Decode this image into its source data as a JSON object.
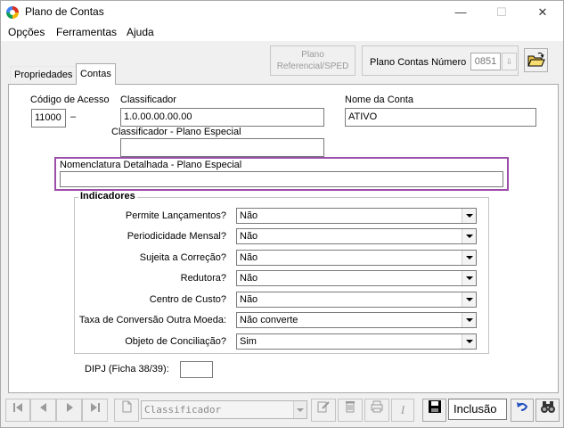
{
  "window": {
    "title": "Plano de Contas",
    "minimize": "—",
    "maximize": "☐",
    "close": "✕"
  },
  "menu": [
    "Opções",
    "Ferramentas",
    "Ajuda"
  ],
  "tabs": [
    "Propriedades",
    "Contas"
  ],
  "header": {
    "plano_ref_line1": "Plano",
    "plano_ref_line2": "Referencial/SPED",
    "plano_contas_numero_label": "Plano Contas Número",
    "plano_contas_numero_value": "0851"
  },
  "form": {
    "codigo_acesso_label": "Código de Acesso",
    "codigo_acesso_value": "11000",
    "separator": "–",
    "classificador_label": "Classificador",
    "classificador_value": "1.0.00.00.00.00",
    "nome_conta_label": "Nome da Conta",
    "nome_conta_value": "ATIVO",
    "classificador_plano_especial_label": "Classificador  - Plano Especial",
    "classificador_plano_especial_value": "",
    "nomenclatura_label": "Nomenclatura Detalhada - Plano Especial",
    "nomenclatura_value": ""
  },
  "indicadores": {
    "title": "Indicadores",
    "items": [
      {
        "label": "Permite Lançamentos?",
        "value": "Não"
      },
      {
        "label": "Periodicidade Mensal?",
        "value": "Não"
      },
      {
        "label": "Sujeita a Correção?",
        "value": "Não"
      },
      {
        "label": "Redutora?",
        "value": "Não"
      },
      {
        "label": "Centro de Custo?",
        "value": "Não"
      },
      {
        "label": "Taxa de Conversão Outra Moeda:",
        "value": "Não converte"
      },
      {
        "label": "Objeto de Conciliação?",
        "value": "Sim"
      }
    ]
  },
  "dipj": {
    "label": "DIPJ (Ficha 38/39):",
    "value": ""
  },
  "toolbar": {
    "search_placeholder": "Classificador",
    "mode": "Inclusão",
    "italic_glyph": "I"
  },
  "colors": {
    "highlight_frame": "#9b4da9",
    "panel": "#ffffff",
    "chrome": "#f0f0f0"
  }
}
